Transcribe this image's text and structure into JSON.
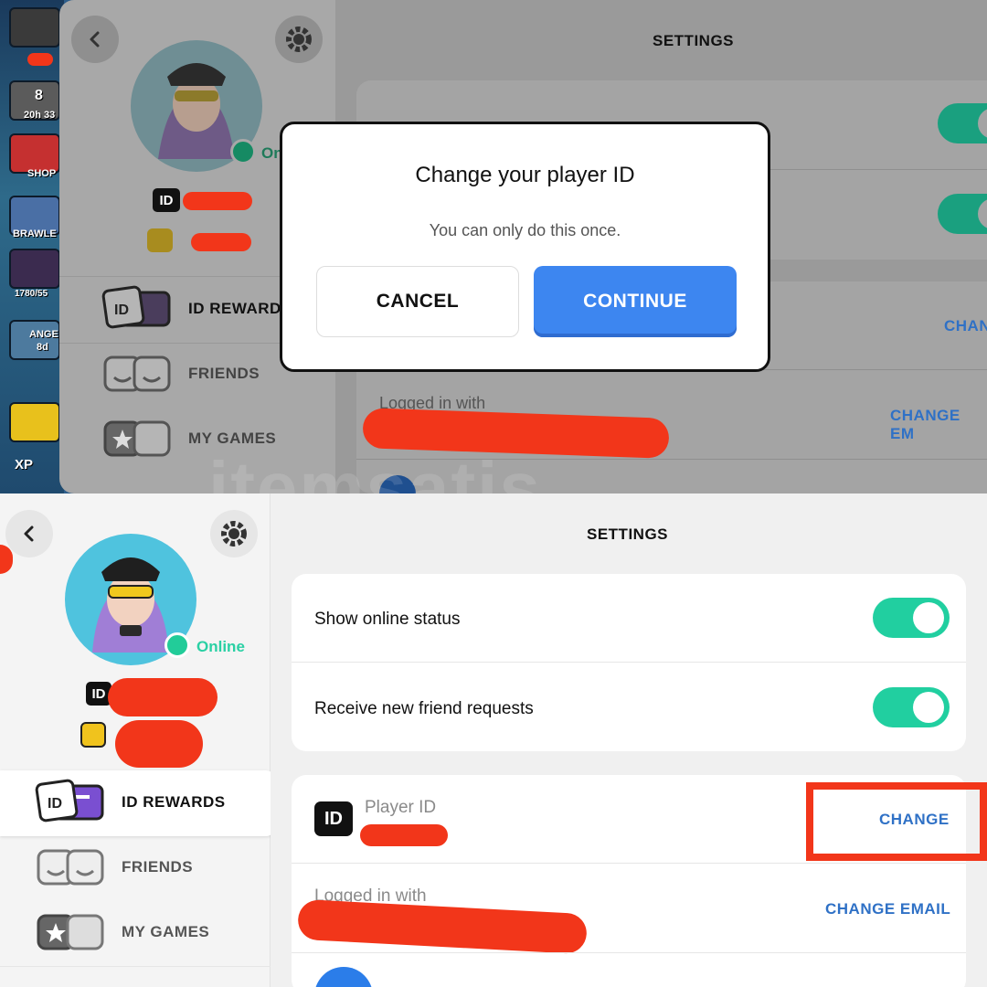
{
  "top": {
    "game": {
      "timer_value": "8",
      "timer_label": "20h 33",
      "shop_label": "SHOP",
      "brawlers_label": "BRAWLE",
      "trophies_label": "1780/55",
      "angel_label": "ANGE",
      "angel_sub": "8d",
      "xp_label": "XP"
    },
    "sidebar": {
      "online_partial": "On",
      "menu": [
        {
          "label": "ID REWARDS"
        },
        {
          "label": "FRIENDS"
        },
        {
          "label": "MY GAMES"
        }
      ]
    },
    "main": {
      "title": "SETTINGS",
      "change_partial": "CHAN",
      "logged_in_label": "Logged in with",
      "change_email_partial": "CHANGE EM"
    },
    "dialog": {
      "title": "Change your player ID",
      "subtitle": "You can only do this once.",
      "cancel_label": "CANCEL",
      "continue_label": "CONTINUE"
    },
    "watermark": "itemsatis"
  },
  "bottom": {
    "sidebar": {
      "online_label": "Online",
      "id_badge": "ID",
      "menu": [
        {
          "label": "ID REWARDS",
          "selected": true
        },
        {
          "label": "FRIENDS",
          "selected": false
        },
        {
          "label": "MY GAMES",
          "selected": false
        }
      ]
    },
    "main": {
      "title": "SETTINGS",
      "toggles": [
        {
          "label": "Show online status",
          "on": true
        },
        {
          "label": "Receive new friend requests",
          "on": true
        }
      ],
      "player_id_label": "Player ID",
      "id_badge": "ID",
      "change_label": "CHANGE",
      "logged_in_label": "Logged in with",
      "change_email_label": "CHANGE EMAIL"
    }
  },
  "colors": {
    "accent_green": "#21cfa0",
    "link_blue": "#2f71c6",
    "continue_blue": "#3d86f0",
    "redaction_red": "#f2361a"
  }
}
